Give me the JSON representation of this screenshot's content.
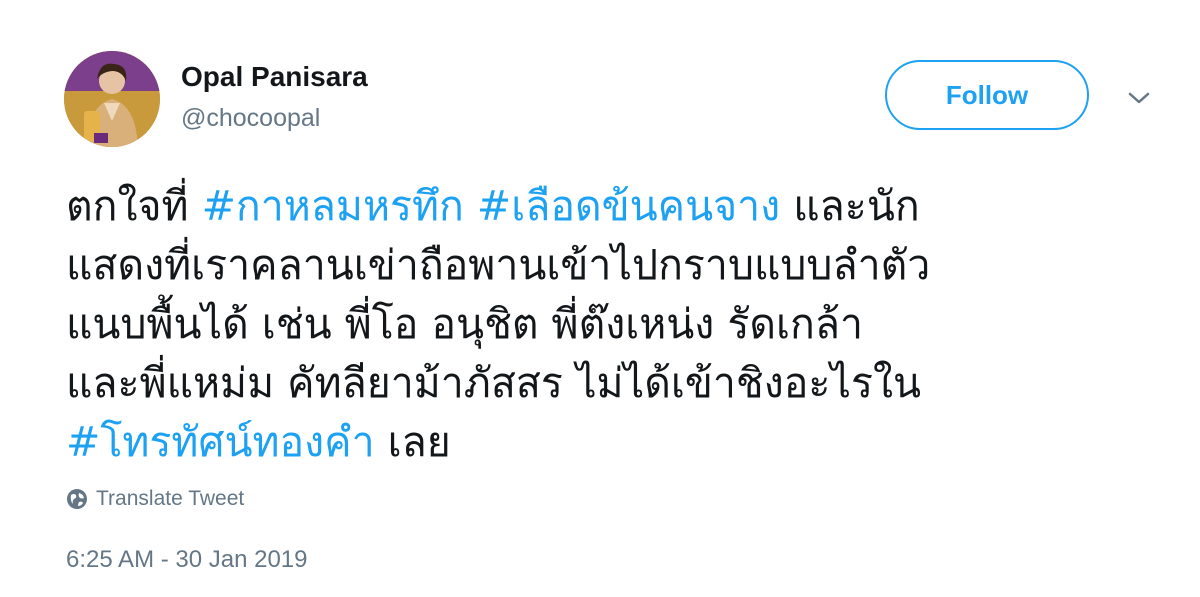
{
  "author": {
    "name": "Opal Panisara",
    "handle": "@chocoopal"
  },
  "follow_button": {
    "label": "Follow"
  },
  "tweet": {
    "lines": [
      [
        {
          "text": "ตกใจที่ ",
          "hashtag": false
        },
        {
          "text": "#กาหลมหรทึก",
          "hashtag": true
        },
        {
          "text": " ",
          "hashtag": false
        },
        {
          "text": "#เลือดข้นคนจาง",
          "hashtag": true
        },
        {
          "text": " และนัก",
          "hashtag": false
        }
      ],
      [
        {
          "text": "แสดงที่เราคลานเข่าถือพานเข้าไปกราบแบบลำตัว",
          "hashtag": false
        }
      ],
      [
        {
          "text": "แนบพื้นได้ เช่น พี่โอ อนุชิต  พี่ต๊งเหน่ง รัดเกล้า",
          "hashtag": false
        }
      ],
      [
        {
          "text": "และพี่แหม่ม คัทลียาม้าภัสสร ไม่ได้เข้าชิงอะไรใน",
          "hashtag": false
        }
      ],
      [
        {
          "text": "#โทรทัศน์ทองคำ",
          "hashtag": true
        },
        {
          "text": " เลย",
          "hashtag": false
        }
      ]
    ]
  },
  "translate": {
    "label": "Translate Tweet",
    "icon": "globe-icon"
  },
  "timestamp": "6:25 AM - 30 Jan 2019",
  "colors": {
    "accent": "#1da1f2",
    "text": "#14171a",
    "muted": "#657786"
  }
}
